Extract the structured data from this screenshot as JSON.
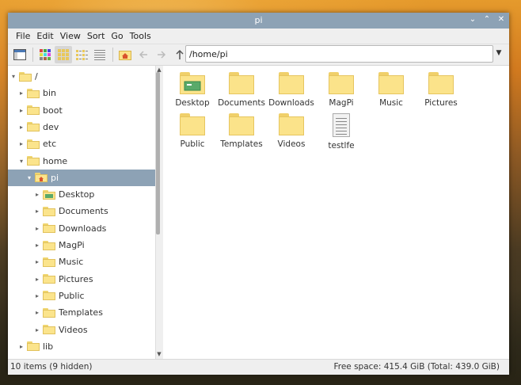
{
  "window": {
    "title": "pi"
  },
  "menu": [
    "File",
    "Edit",
    "View",
    "Sort",
    "Go",
    "Tools"
  ],
  "address": {
    "value": "/home/pi"
  },
  "tree": [
    {
      "label": "/",
      "expander": "▾"
    },
    {
      "label": "bin",
      "expander": "▸"
    },
    {
      "label": "boot",
      "expander": "▸"
    },
    {
      "label": "dev",
      "expander": "▸"
    },
    {
      "label": "etc",
      "expander": "▸"
    },
    {
      "label": "home",
      "expander": "▾"
    },
    {
      "label": "pi",
      "expander": "▾"
    },
    {
      "label": "Desktop",
      "expander": "▸"
    },
    {
      "label": "Documents",
      "expander": "▸"
    },
    {
      "label": "Downloads",
      "expander": "▸"
    },
    {
      "label": "MagPi",
      "expander": "▸"
    },
    {
      "label": "Music",
      "expander": "▸"
    },
    {
      "label": "Pictures",
      "expander": "▸"
    },
    {
      "label": "Public",
      "expander": "▸"
    },
    {
      "label": "Templates",
      "expander": "▸"
    },
    {
      "label": "Videos",
      "expander": "▸"
    },
    {
      "label": "lib",
      "expander": "▸"
    }
  ],
  "items": [
    {
      "label": "Desktop",
      "kind": "desktop-folder"
    },
    {
      "label": "Documents",
      "kind": "folder"
    },
    {
      "label": "Downloads",
      "kind": "folder"
    },
    {
      "label": "MagPi",
      "kind": "folder"
    },
    {
      "label": "Music",
      "kind": "folder"
    },
    {
      "label": "Pictures",
      "kind": "folder"
    },
    {
      "label": "Public",
      "kind": "folder"
    },
    {
      "label": "Templates",
      "kind": "folder"
    },
    {
      "label": "Videos",
      "kind": "folder"
    },
    {
      "label": "testlfe",
      "kind": "text-file"
    }
  ],
  "status": {
    "left": "10 items (9 hidden)",
    "right": "Free space: 415.4 GiB (Total: 439.0 GiB)"
  },
  "colors": {
    "selection": "#8da2b5",
    "titlebar": "#8da2b5",
    "folder": "#fbe38a"
  }
}
